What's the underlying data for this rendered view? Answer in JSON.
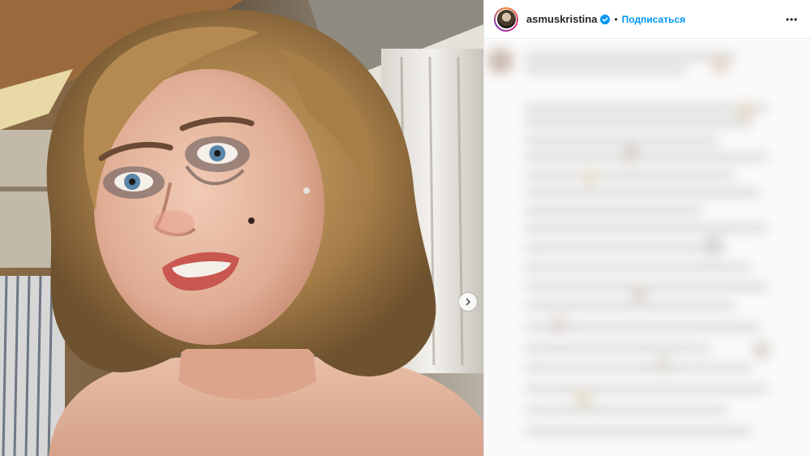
{
  "post": {
    "username": "asmuskristina",
    "separator": "•",
    "follow_label": "Подписаться",
    "accent_color": "#0095f6",
    "verified_icon": "verified-badge-icon",
    "more_icon": "more-options-icon"
  },
  "media": {
    "next_icon": "chevron-right-icon"
  }
}
